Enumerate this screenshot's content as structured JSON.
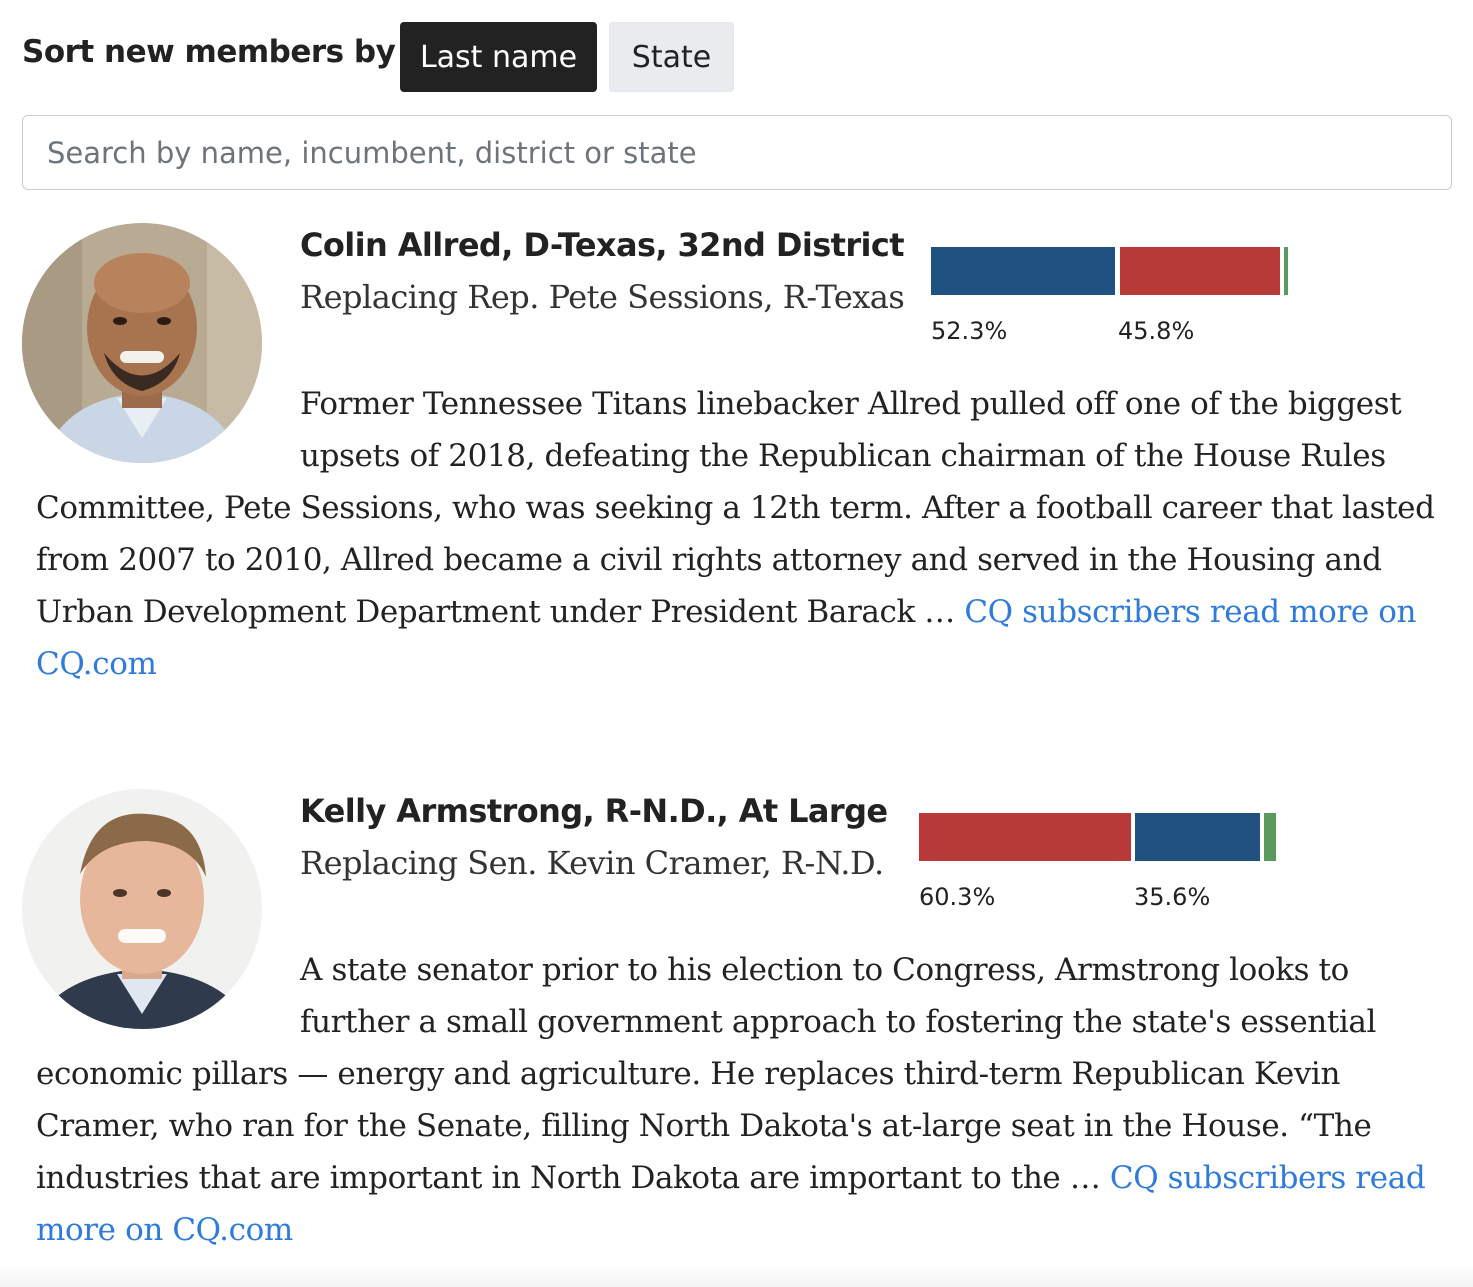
{
  "sort": {
    "label": "Sort new members by",
    "options": [
      "Last name",
      "State"
    ],
    "selected": "Last name"
  },
  "search": {
    "placeholder": "Search by name, incumbent, district or state",
    "value": ""
  },
  "colors": {
    "democrat": "#1f5280",
    "republican": "#b83a38",
    "other": "#5a9a5c",
    "link": "#2f7bdc"
  },
  "members": [
    {
      "name": "Colin Allred, D-Texas, 32nd District",
      "replacing": "Replacing Rep. Pete Sessions, R-Texas",
      "results": [
        {
          "party": "democrat",
          "share": 52.3,
          "label": "52.3%"
        },
        {
          "party": "republican",
          "share": 45.8,
          "label": "45.8%"
        },
        {
          "party": "other",
          "share": 1.9,
          "label": ""
        }
      ],
      "bio": "Former Tennessee Titans linebacker Allred pulled off one of the biggest upsets of 2018, defeating the Republican chairman of the House Rules Committee, Pete Sessions, who was seeking a 12th term. After a football career that lasted from 2007 to 2010, Allred became a civil rights attorney and served in the Housing and Urban Development Department under President Barack …",
      "link": "CQ subscribers read more on CQ.com"
    },
    {
      "name": "Kelly Armstrong, R-N.D., At Large",
      "replacing": "Replacing Sen. Kevin Cramer, R-N.D.",
      "results": [
        {
          "party": "republican",
          "share": 60.3,
          "label": "60.3%"
        },
        {
          "party": "democrat",
          "share": 35.6,
          "label": "35.6%"
        },
        {
          "party": "other",
          "share": 4.1,
          "label": ""
        }
      ],
      "bio": "A state senator prior to his election to Congress, Armstrong looks to further a small government approach to fostering the state's essential economic pillars — energy and agriculture. He replaces third-term Republican Kevin Cramer, who ran for the Senate, filling North Dakota's at-large seat in the House. “The industries that are important in North Dakota are important to the …",
      "link": "CQ subscribers read more on CQ.com"
    }
  ]
}
